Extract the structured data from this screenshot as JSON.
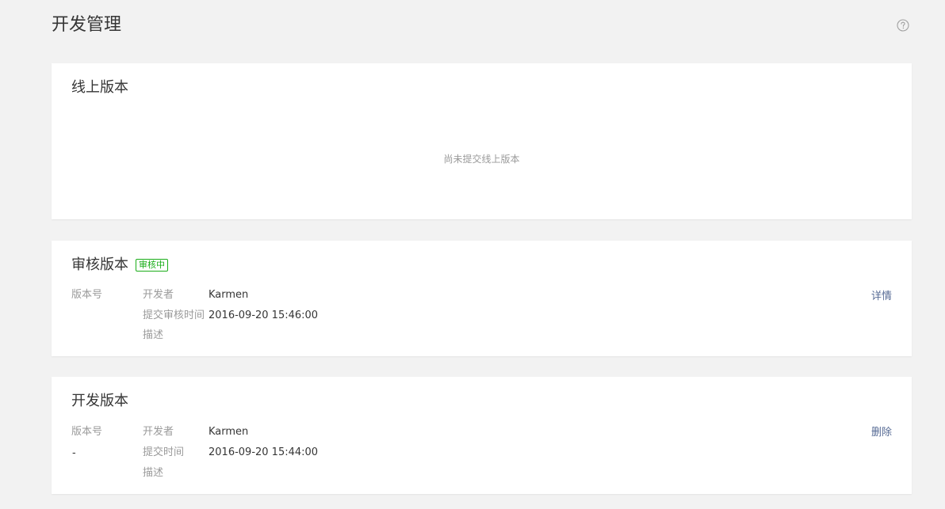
{
  "header": {
    "title": "开发管理",
    "help_icon": "question-circle-icon"
  },
  "online_version": {
    "title": "线上版本",
    "empty_message": "尚未提交线上版本"
  },
  "review_version": {
    "title": "审核版本",
    "status_badge": "审核中",
    "status_color": "#1aad19",
    "version_label": "版本号",
    "developer_label": "开发者",
    "developer_value": "Karmen",
    "submit_time_label": "提交审核时间",
    "submit_time_value": "2016-09-20 15:46:00",
    "description_label": "描述",
    "action_label": "详情"
  },
  "dev_version": {
    "title": "开发版本",
    "version_label": "版本号",
    "version_value": "-",
    "developer_label": "开发者",
    "developer_value": "Karmen",
    "submit_time_label": "提交时间",
    "submit_time_value": "2016-09-20 15:44:00",
    "description_label": "描述",
    "action_label": "删除"
  },
  "colors": {
    "link": "#576b95",
    "muted": "#9a9a9a",
    "background": "#f2f2f2"
  }
}
